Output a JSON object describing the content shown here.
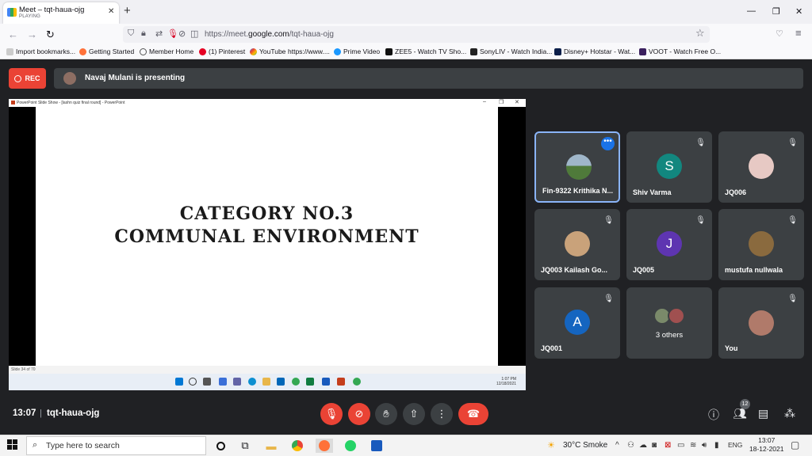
{
  "browser": {
    "tab_title": "Meet – tqt-haua-ojg",
    "tab_status": "PLAYING",
    "url_prefix": "https://meet.",
    "url_domain": "google.com",
    "url_path": "/tqt-haua-ojg"
  },
  "bookmarks": [
    {
      "label": "Import bookmarks...",
      "icon": "import-icon"
    },
    {
      "label": "Getting Started",
      "icon": "firefox-icon"
    },
    {
      "label": "Member Home",
      "icon": "globe-icon"
    },
    {
      "label": "(1) Pinterest",
      "icon": "pinterest-icon"
    },
    {
      "label": "YouTube",
      "icon": "google-icon"
    },
    {
      "label": "https://www....",
      "icon": "link-icon"
    },
    {
      "label": "Prime Video",
      "icon": "prime-icon"
    },
    {
      "label": "ZEE5 - Watch TV Sho...",
      "icon": "zee5-icon"
    },
    {
      "label": "SonyLIV - Watch India...",
      "icon": "sonyliv-icon"
    },
    {
      "label": "Disney+ Hotstar - Wat...",
      "icon": "hotstar-icon"
    },
    {
      "label": "VOOT - Watch Free O...",
      "icon": "voot-icon"
    }
  ],
  "meet": {
    "rec_label": "REC",
    "presenting_text": "Navaj Mulani is presenting",
    "ppt_window_title": "PowerPoint Slide Show - [lashn quiz final round] - PowerPoint",
    "slide_line1": "Category No.3",
    "slide_line2": "Communal Environment",
    "slide_status": "Slide 34 of 70",
    "mini_time": "1:07 PM",
    "mini_date": "12/18/2021",
    "time": "13:07",
    "meeting_code": "tqt-haua-ojg",
    "participant_count": "12",
    "tiles": [
      {
        "name": "Fin-9322 Krithika N...",
        "avatar": "",
        "color": "#5b7a3a",
        "muted": false,
        "selected": true
      },
      {
        "name": "Shiv Varma",
        "avatar": "S",
        "color": "#12877f",
        "muted": true
      },
      {
        "name": "JQ006",
        "avatar": "",
        "color": "#e7c9c4",
        "muted": true
      },
      {
        "name": "JQ003 Kailash Go...",
        "avatar": "",
        "color": "#c9a27a",
        "muted": true
      },
      {
        "name": "JQ005",
        "avatar": "J",
        "color": "#5e35b1",
        "muted": true
      },
      {
        "name": "mustufa nullwala",
        "avatar": "",
        "color": "#8a6a3e",
        "muted": true
      },
      {
        "name": "JQ001",
        "avatar": "A",
        "color": "#1565c0",
        "muted": true
      },
      {
        "name": "3 others",
        "avatar": "",
        "color": "#a05050",
        "muted": false
      },
      {
        "name": "You",
        "avatar": "",
        "color": "#b07a6a",
        "muted": true
      }
    ]
  },
  "windows": {
    "search_placeholder": "Type here to search",
    "weather": "30°C  Smoke",
    "lang": "ENG",
    "clock_time": "13:07",
    "clock_date": "18-12-2021"
  }
}
